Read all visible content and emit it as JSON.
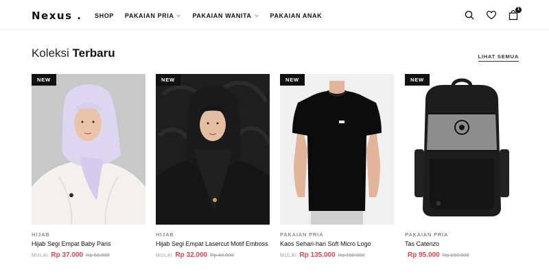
{
  "header": {
    "logo": "Nexus .",
    "nav": [
      {
        "label": "SHOP",
        "dropdown": false
      },
      {
        "label": "PAKAIAN PRIA",
        "dropdown": true
      },
      {
        "label": "PAKAIAN WANITA",
        "dropdown": true
      },
      {
        "label": "PAKAIAN ANAK",
        "dropdown": false
      }
    ],
    "icons": [
      "search-icon",
      "heart-icon",
      "shopping-bag-icon"
    ],
    "cart_count": "1"
  },
  "section": {
    "title_light": "Koleksi",
    "title_bold": "Terbaru",
    "see_all": "LIHAT SEMUA"
  },
  "products": [
    {
      "badge": "NEW",
      "category": "HIJAB",
      "name": "Hijab Segi Empat Baby Paris",
      "from_label": "MULAI",
      "price": "Rp 37.000",
      "old_price": "Rp 58.000"
    },
    {
      "badge": "NEW",
      "category": "HIJAB",
      "name": "Hijab Segi Empat Lasercut Motif Emboss",
      "from_label": "MULAI",
      "price": "Rp 32.000",
      "old_price": "Rp 40.000"
    },
    {
      "badge": "NEW",
      "category": "PAKAIAN PRIA",
      "name": "Kaos Sehari-hari Soft Micro Logo",
      "from_label": "MULAI",
      "price": "Rp 135.000",
      "old_price": "Rp 150.000"
    },
    {
      "badge": "NEW",
      "category": "PAKAIAN PRIA",
      "name": "Tas Catenzo",
      "from_label": "",
      "price": "Rp 95.000",
      "old_price": "Rp 100.000"
    }
  ],
  "colors": {
    "accent_price": "#e5484d",
    "text": "#111111",
    "muted": "#8a8a8a",
    "badge_bg": "#111111"
  }
}
